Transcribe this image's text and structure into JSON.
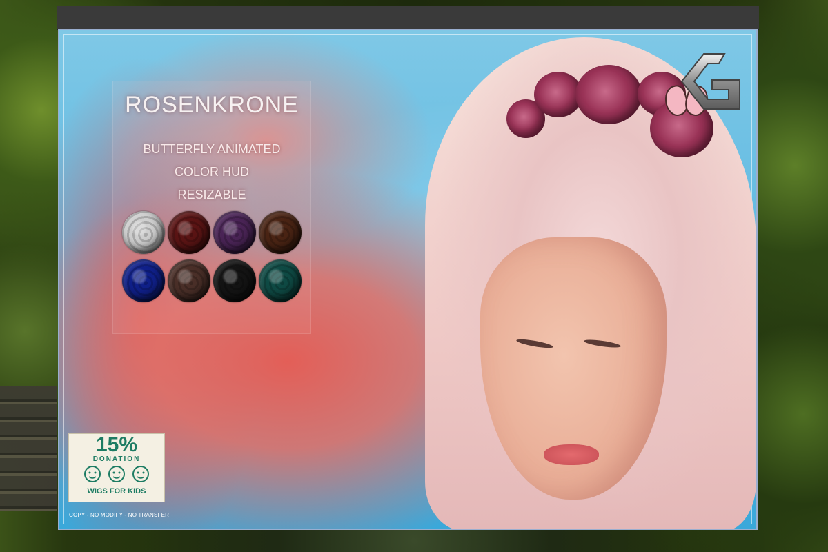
{
  "sign": {
    "product_name": "ROSENKRONE",
    "features": [
      "BUTTERFLY ANIMATED",
      "COLOR HUD",
      "RESIZABLE"
    ],
    "swatch_colors": [
      "#cfcfcf",
      "#5a1414",
      "#4a2456",
      "#4a2414",
      "#10208a",
      "#4a2f28",
      "#141414",
      "#0f4a44"
    ],
    "logo_letter": "G",
    "donation": {
      "percent": "15%",
      "label": "DONATION",
      "organization": "WIGS FOR KIDS"
    },
    "permissions": "COPY - NO MODIFY - NO TRANSFER"
  },
  "colors": {
    "sky": "#62bbe2",
    "blossom": "#e85a50",
    "accent_green": "#1d7c63"
  }
}
